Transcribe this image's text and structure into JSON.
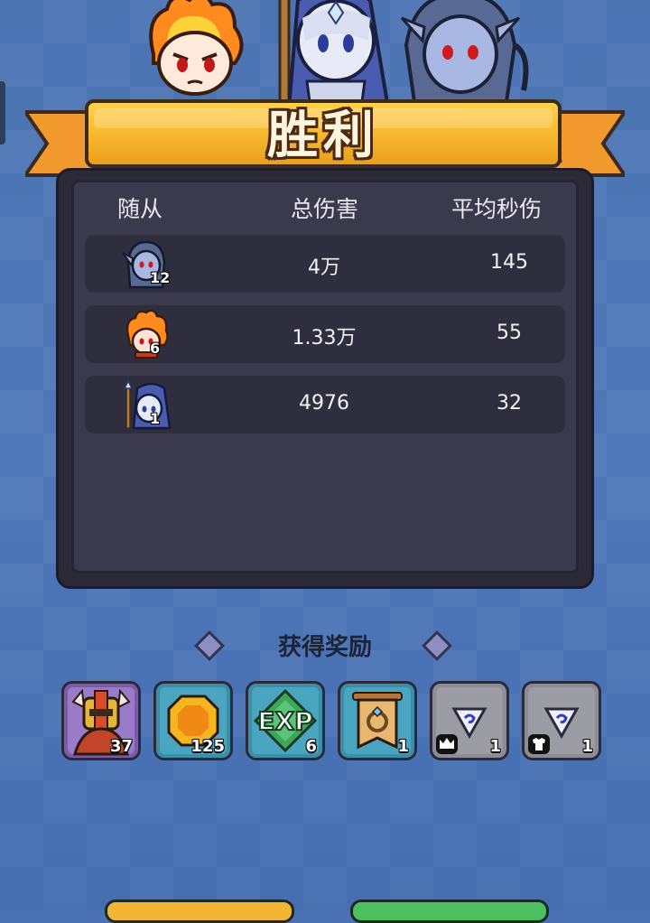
{
  "banner": {
    "title": "胜利"
  },
  "stats": {
    "headers": {
      "follower": "随从",
      "total_damage": "总伤害",
      "avg_dps": "平均秒伤"
    },
    "rows": [
      {
        "avatar_icon": "dark-elf-hero-icon",
        "level": "12",
        "total_damage": "4万",
        "avg_dps": "145"
      },
      {
        "avatar_icon": "fire-hero-icon",
        "level": "6",
        "total_damage": "1.33万",
        "avg_dps": "55"
      },
      {
        "avatar_icon": "ice-mage-hero-icon",
        "level": "1",
        "total_damage": "4976",
        "avg_dps": "32"
      }
    ]
  },
  "rewards": {
    "title": "获得奖励",
    "items": [
      {
        "icon": "armored-hero-shard-icon",
        "count": "37",
        "color": "#7b5ca8"
      },
      {
        "icon": "gold-coin-icon",
        "count": "125",
        "color": "#3c8fa8"
      },
      {
        "icon": "exp-icon",
        "count": "6",
        "color": "#3c8fa8"
      },
      {
        "icon": "ring-scroll-icon",
        "count": "1",
        "color": "#3c8fa8"
      },
      {
        "icon": "blue-gem-crown-icon",
        "count": "1",
        "color": "#8c8c94"
      },
      {
        "icon": "blue-gem-armor-icon",
        "count": "1",
        "color": "#8c8c94"
      }
    ]
  },
  "colors": {
    "banner_gold": "#f7b62e",
    "ribbon_orange": "#f29a2e",
    "panel_dark": "#2c2a39",
    "background_blue": "#4d77b8"
  }
}
